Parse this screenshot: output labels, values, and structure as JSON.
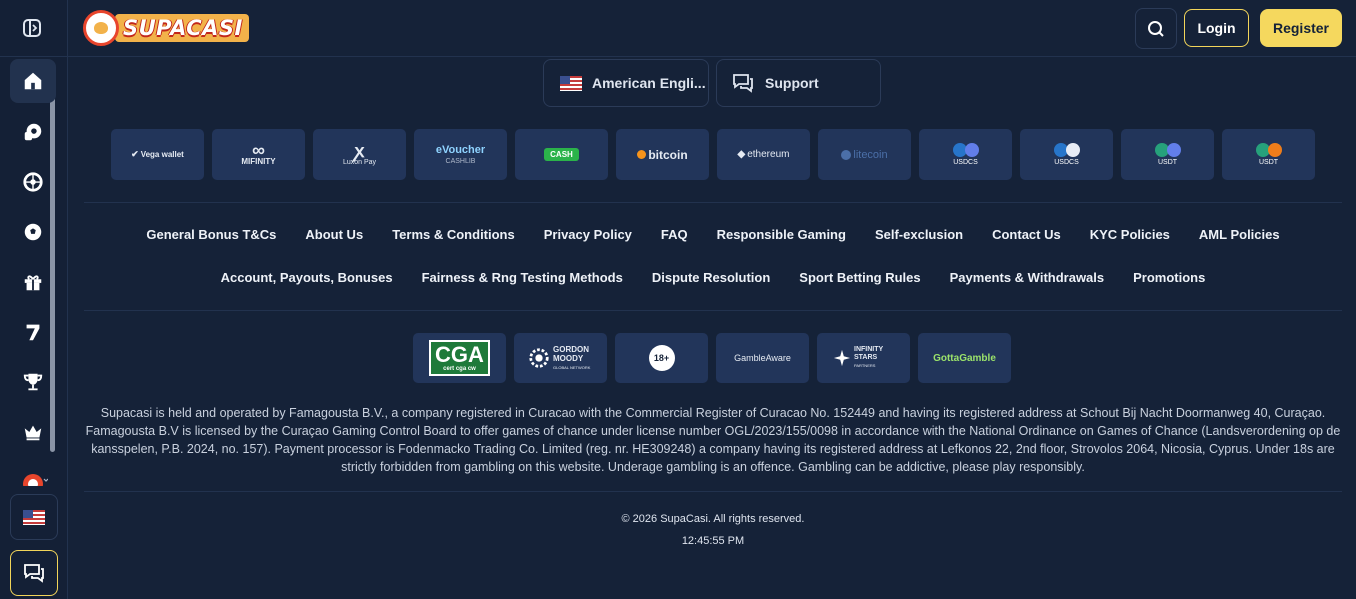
{
  "header": {
    "logo_text": "SUPACASI",
    "login_label": "Login",
    "register_label": "Register"
  },
  "sidebar": {
    "items": [
      {
        "icon": "home-icon",
        "active": true
      },
      {
        "icon": "casino-chip-icon"
      },
      {
        "icon": "roulette-icon"
      },
      {
        "icon": "soccer-ball-icon"
      },
      {
        "icon": "gift-icon"
      },
      {
        "icon": "seven-slot-icon"
      },
      {
        "icon": "trophy-icon"
      },
      {
        "icon": "crown-icon"
      }
    ]
  },
  "utility": {
    "language_label": "American Engli...",
    "support_label": "Support"
  },
  "payments": [
    {
      "label": "Vega wallet",
      "sub": ""
    },
    {
      "label": "MIFINITY",
      "sub": ""
    },
    {
      "label": "Luxon Pay",
      "sub": ""
    },
    {
      "label": "eVoucher",
      "sub": "CASHLIB"
    },
    {
      "label": "CASH",
      "sub": ""
    },
    {
      "label": "bitcoin",
      "sub": ""
    },
    {
      "label": "ethereum",
      "sub": ""
    },
    {
      "label": "litecoin",
      "sub": ""
    },
    {
      "label": "USDCS",
      "sub": "BEP20"
    },
    {
      "label": "USDCS",
      "sub": "ERC20"
    },
    {
      "label": "USDT",
      "sub": "ERC20"
    },
    {
      "label": "USDT",
      "sub": "TRC20"
    }
  ],
  "footer_links_row1": [
    "General Bonus T&Cs",
    "About Us",
    "Terms & Conditions",
    "Privacy Policy",
    "FAQ",
    "Responsible Gaming",
    "Self-exclusion",
    "Contact Us",
    "KYC Policies",
    "AML Policies"
  ],
  "footer_links_row2": [
    "Account, Payouts, Bonuses",
    "Fairness & Rng Testing Methods",
    "Dispute Resolution",
    "Sport Betting Rules",
    "Payments & Withdrawals",
    "Promotions"
  ],
  "licenses": {
    "cga": "CGA",
    "cga_sub": "cert cga cw",
    "gordon": "GORDON MOODY",
    "gordon_sub": "GLOBAL NETWORK",
    "age": "18+",
    "gambleaware": "GambleAware",
    "infinity": "INFINITY STARS",
    "infinity_sub": "PARTNERS",
    "gotta": "GottaGamble"
  },
  "disclaimer": "Supacasi is held and operated by Famagousta B.V., a company registered in Curacao with the Commercial Register of Curacao No. 152449 and having its registered address at Schout Bij Nacht Doormanweg 40, Curaçao. Famagousta B.V is licensed by the Curaçao Gaming Control Board to offer games of chance under license number OGL/2023/155/0098 in accordance with the National Ordinance on Games of Chance (Landsverordening op de kansspelen, P.B. 2024, no. 157). Payment processor is Fodenmacko Trading Co. Limited (reg. nr. HE309248) a company having its registered address at Lefkonos 22, 2nd floor, Strovolos 2064, Nicosia, Cyprus. Under 18s are strictly forbidden from gambling on this website. Underage gambling is an offence. Gambling can be addictive, please play responsibly.",
  "copyright": "© 2026 SupaCasi. All rights reserved.",
  "time": "12:45:55 PM",
  "colors": {
    "background": "#152238",
    "accent": "#f5d85e",
    "tile": "#22355a"
  }
}
